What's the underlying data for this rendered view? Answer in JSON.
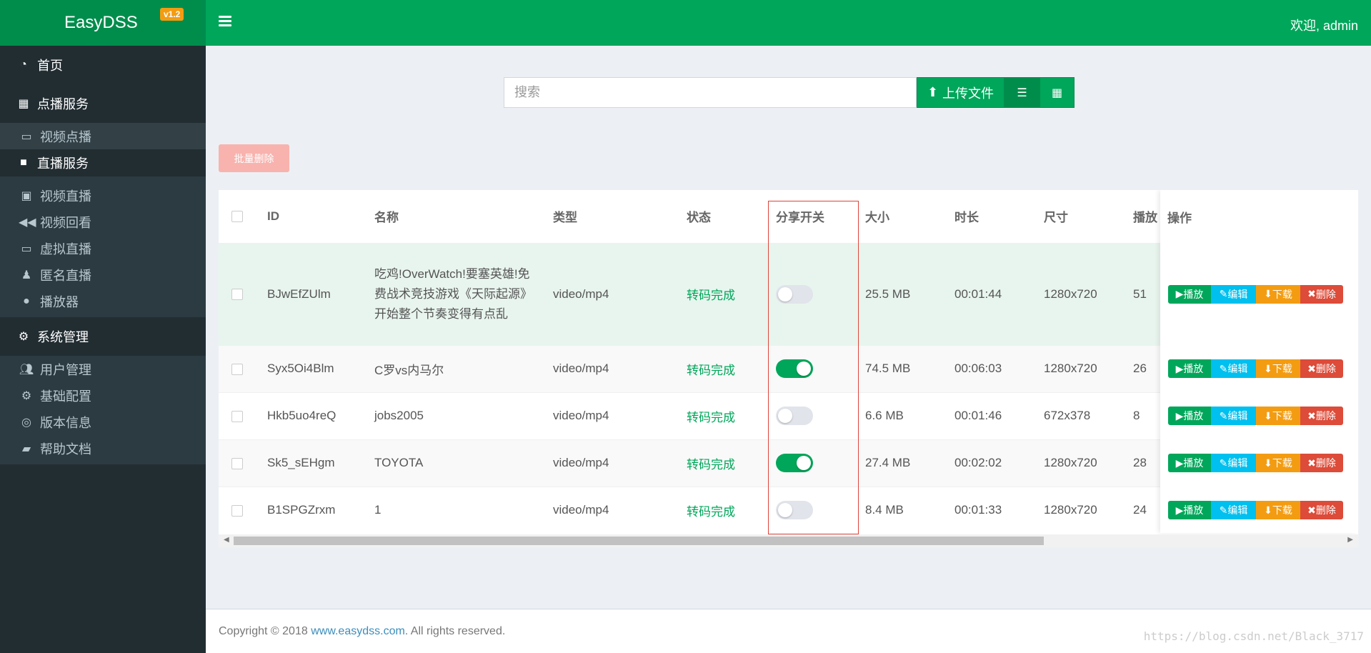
{
  "header": {
    "app_name": "EasyDSS",
    "version": "v1.2",
    "welcome": "欢迎, admin"
  },
  "sidebar": {
    "home": "首页",
    "vod_group": "点播服务",
    "vod_items": [
      "视频点播"
    ],
    "live_group": "直播服务",
    "live_items": [
      "视频直播",
      "视频回看",
      "虚拟直播",
      "匿名直播",
      "播放器"
    ],
    "sys_group": "系统管理",
    "sys_items": [
      "用户管理",
      "基础配置",
      "版本信息",
      "帮助文档"
    ]
  },
  "search": {
    "placeholder": "搜索"
  },
  "toolbar": {
    "upload_label": "上传文件",
    "batch_delete_label": "批量删除"
  },
  "table": {
    "columns": [
      "ID",
      "名称",
      "类型",
      "状态",
      "分享开关",
      "大小",
      "时长",
      "尺寸",
      "播放",
      "操作"
    ],
    "rows": [
      {
        "id": "BJwEfZUlm",
        "name": "吃鸡!OverWatch!要塞英雄!免费战术竞技游戏《天际起源》开始整个节奏变得有点乱",
        "type": "video/mp4",
        "status": "转码完成",
        "share": false,
        "size": "25.5 MB",
        "duration": "00:01:44",
        "resolution": "1280x720",
        "plays": "51"
      },
      {
        "id": "Syx5Oi4Blm",
        "name": "C罗vs内马尔",
        "type": "video/mp4",
        "status": "转码完成",
        "share": true,
        "size": "74.5 MB",
        "duration": "00:06:03",
        "resolution": "1280x720",
        "plays": "26"
      },
      {
        "id": "Hkb5uo4reQ",
        "name": "jobs2005",
        "type": "video/mp4",
        "status": "转码完成",
        "share": false,
        "size": "6.6 MB",
        "duration": "00:01:46",
        "resolution": "672x378",
        "plays": "8"
      },
      {
        "id": "Sk5_sEHgm",
        "name": "TOYOTA",
        "type": "video/mp4",
        "status": "转码完成",
        "share": true,
        "size": "27.4 MB",
        "duration": "00:02:02",
        "resolution": "1280x720",
        "plays": "28"
      },
      {
        "id": "B1SPGZrxm",
        "name": "1",
        "type": "video/mp4",
        "status": "转码完成",
        "share": false,
        "size": "8.4 MB",
        "duration": "00:01:33",
        "resolution": "1280x720",
        "plays": "24"
      }
    ],
    "ops": {
      "play": "播放",
      "edit": "编辑",
      "download": "下载",
      "delete": "删除"
    }
  },
  "footer": {
    "prefix": "Copyright © 2018 ",
    "link": "www.easydss.com",
    "suffix": ". All rights reserved.",
    "watermark": "https://blog.csdn.net/Black_3717"
  },
  "colors": {
    "brand_green": "#00a65a",
    "sidebar_bg": "#222d32",
    "edit_blue": "#00c0ef",
    "download_orange": "#f39c12",
    "delete_red": "#dd4b39"
  }
}
